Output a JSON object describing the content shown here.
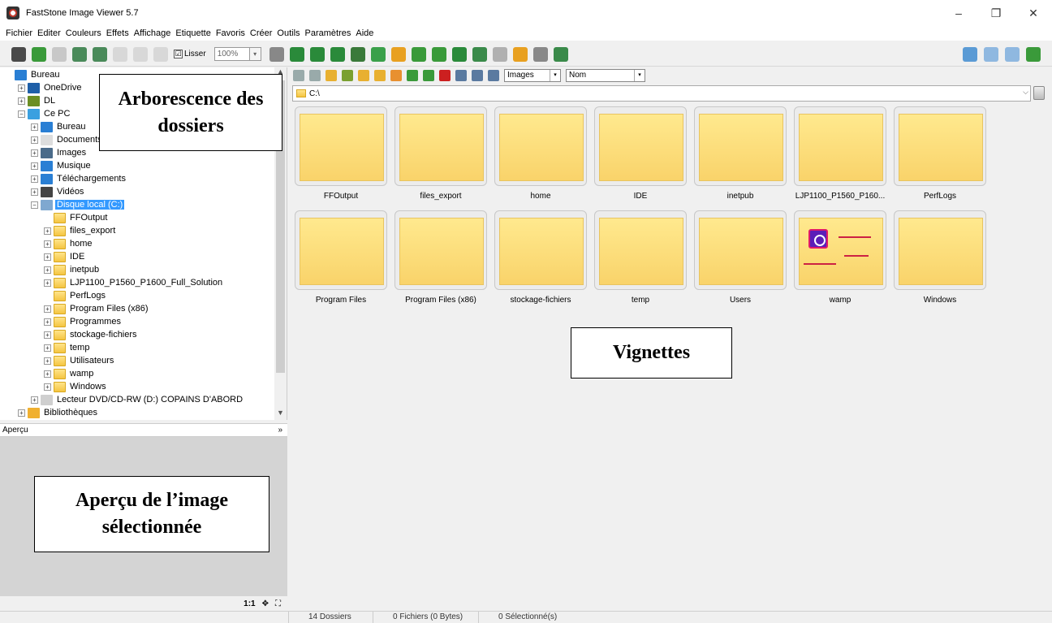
{
  "window": {
    "title": "FastStone Image Viewer 5.7",
    "minimize": "–",
    "restore": "❐",
    "close": "✕"
  },
  "menu": [
    "Fichier",
    "Editer",
    "Couleurs",
    "Effets",
    "Affichage",
    "Etiquette",
    "Favoris",
    "Créer",
    "Outils",
    "Paramètres",
    "Aide"
  ],
  "toolbar": {
    "smooth_label": "Lisser",
    "smooth_checked": "☑",
    "zoom_value": "100%",
    "zoom_dropdown": "▾",
    "hand_dropdown": "▾"
  },
  "tree": {
    "items": [
      {
        "label": "Bureau",
        "indent": 0,
        "expander": "",
        "icon": "desktop-icon",
        "color": "#2a7fd4"
      },
      {
        "label": "OneDrive",
        "indent": 1,
        "expander": "+",
        "icon": "cloud-icon",
        "color": "#1e5fa8"
      },
      {
        "label": "DL",
        "indent": 1,
        "expander": "+",
        "icon": "user-icon",
        "color": "#6b8e23"
      },
      {
        "label": "Ce PC",
        "indent": 1,
        "expander": "−",
        "icon": "computer-icon",
        "color": "#3aa0e0"
      },
      {
        "label": "Bureau",
        "indent": 2,
        "expander": "+",
        "icon": "desktop-icon",
        "color": "#2a7fd4"
      },
      {
        "label": "Documents",
        "indent": 2,
        "expander": "+",
        "icon": "document-icon",
        "color": "#ddd"
      },
      {
        "label": "Images",
        "indent": 2,
        "expander": "+",
        "icon": "images-icon",
        "color": "#4a6b8a"
      },
      {
        "label": "Musique",
        "indent": 2,
        "expander": "+",
        "icon": "music-icon",
        "color": "#2a7fd4"
      },
      {
        "label": "Téléchargements",
        "indent": 2,
        "expander": "+",
        "icon": "download-icon",
        "color": "#2a7fd4"
      },
      {
        "label": "Vidéos",
        "indent": 2,
        "expander": "+",
        "icon": "video-icon",
        "color": "#444"
      },
      {
        "label": "Disque local (C:)",
        "indent": 2,
        "expander": "−",
        "icon": "drive-icon",
        "color": "#7fa8d0",
        "selected": true
      },
      {
        "label": "FFOutput",
        "indent": 3,
        "expander": "",
        "icon": "folder-icon"
      },
      {
        "label": "files_export",
        "indent": 3,
        "expander": "+",
        "icon": "folder-icon"
      },
      {
        "label": "home",
        "indent": 3,
        "expander": "+",
        "icon": "folder-icon"
      },
      {
        "label": "IDE",
        "indent": 3,
        "expander": "+",
        "icon": "folder-icon"
      },
      {
        "label": "inetpub",
        "indent": 3,
        "expander": "+",
        "icon": "folder-icon"
      },
      {
        "label": "LJP1100_P1560_P1600_Full_Solution",
        "indent": 3,
        "expander": "+",
        "icon": "folder-icon"
      },
      {
        "label": "PerfLogs",
        "indent": 3,
        "expander": "",
        "icon": "folder-icon"
      },
      {
        "label": "Program Files (x86)",
        "indent": 3,
        "expander": "+",
        "icon": "folder-icon"
      },
      {
        "label": "Programmes",
        "indent": 3,
        "expander": "+",
        "icon": "folder-icon"
      },
      {
        "label": "stockage-fichiers",
        "indent": 3,
        "expander": "+",
        "icon": "folder-icon"
      },
      {
        "label": "temp",
        "indent": 3,
        "expander": "+",
        "icon": "folder-icon"
      },
      {
        "label": "Utilisateurs",
        "indent": 3,
        "expander": "+",
        "icon": "folder-icon"
      },
      {
        "label": "wamp",
        "indent": 3,
        "expander": "+",
        "icon": "folder-icon"
      },
      {
        "label": "Windows",
        "indent": 3,
        "expander": "+",
        "icon": "folder-icon"
      },
      {
        "label": "Lecteur DVD/CD-RW (D:) COPAINS D'ABORD",
        "indent": 2,
        "expander": "+",
        "icon": "dvd-icon",
        "color": "#cfcfcf"
      },
      {
        "label": "Bibliothèques",
        "indent": 1,
        "expander": "+",
        "icon": "library-icon",
        "color": "#f0b030"
      }
    ]
  },
  "preview": {
    "header": "Aperçu",
    "collapse": "»",
    "footer": {
      "ratio": "1:1",
      "fit_icon": "✥",
      "full_icon": "⛶"
    }
  },
  "nav": {
    "filter_value": "Images",
    "sort_value": "Nom",
    "dropdown": "▾",
    "path": "C:\\",
    "path_dropdown": "⌵"
  },
  "thumbnails": [
    {
      "label": "FFOutput"
    },
    {
      "label": "files_export"
    },
    {
      "label": "home"
    },
    {
      "label": "IDE"
    },
    {
      "label": "inetpub"
    },
    {
      "label": "LJP1100_P1560_P160..."
    },
    {
      "label": "PerfLogs"
    },
    {
      "label": "Program Files"
    },
    {
      "label": "Program Files (x86)"
    },
    {
      "label": "stockage-fichiers"
    },
    {
      "label": "temp"
    },
    {
      "label": "Users"
    },
    {
      "label": "wamp",
      "special": "wamp"
    },
    {
      "label": "Windows"
    }
  ],
  "annotations": {
    "tree": "Arborescence des dossiers",
    "thumbs": "Vignettes",
    "preview": "Aperçu de l’image sélectionnée"
  },
  "status": {
    "folders": "14 Dossiers",
    "files": "0 Fichiers (0 Bytes)",
    "selected": "0 Sélectionné(s)"
  },
  "toolbar_icons": [
    {
      "name": "camera-icon",
      "color": "#4a4a4a"
    },
    {
      "name": "open-folder-icon",
      "color": "#3a9a3a"
    },
    {
      "name": "save-icon",
      "color": "#c8c8c8"
    },
    {
      "name": "save-as-icon",
      "color": "#4a8a5a"
    },
    {
      "name": "export-icon",
      "color": "#4a8a5a"
    },
    {
      "name": "zoom-in-icon",
      "color": "#d8d8d8"
    },
    {
      "name": "zoom-out-icon",
      "color": "#d8d8d8"
    },
    {
      "name": "actual-size-icon",
      "color": "#d8d8d8"
    }
  ],
  "toolbar_icons2": [
    {
      "name": "hand-icon",
      "color": "#888888"
    },
    {
      "name": "slideshow-icon",
      "color": "#2a8a3a"
    },
    {
      "name": "compare-icon",
      "color": "#2a8a3a"
    },
    {
      "name": "batch-icon",
      "color": "#2a8a3a"
    },
    {
      "name": "rename-icon",
      "color": "#3a7a3a"
    },
    {
      "name": "contact-icon",
      "color": "#3aa04a"
    },
    {
      "name": "effects-icon",
      "color": "#e8a020"
    },
    {
      "name": "rotate-left-icon",
      "color": "#3a9a3a"
    },
    {
      "name": "rotate-right-icon",
      "color": "#3a9a3a"
    },
    {
      "name": "histogram-icon",
      "color": "#2a8a3a"
    },
    {
      "name": "resize-icon",
      "color": "#3a8a4a"
    },
    {
      "name": "draw-icon",
      "color": "#b0b0b0"
    },
    {
      "name": "email-icon",
      "color": "#e8a020"
    },
    {
      "name": "print-icon",
      "color": "#888888"
    },
    {
      "name": "settings-icon",
      "color": "#3a8a4a"
    }
  ],
  "layout_icons": [
    {
      "name": "layout-browser-icon",
      "color": "#5b9bd5"
    },
    {
      "name": "layout-single-icon",
      "color": "#8fb8e0"
    },
    {
      "name": "layout-preview-icon",
      "color": "#8fb8e0"
    },
    {
      "name": "fullscreen-icon",
      "color": "#3a9a3a"
    }
  ],
  "nav_icons": [
    {
      "name": "back-icon",
      "color": "#9aa"
    },
    {
      "name": "forward-icon",
      "color": "#9aa"
    },
    {
      "name": "up-folder-icon",
      "color": "#e8b030"
    },
    {
      "name": "folder-green-icon",
      "color": "#7aa030"
    },
    {
      "name": "favorites-folder-icon",
      "color": "#e8b030"
    },
    {
      "name": "new-folder-icon",
      "color": "#e8b030"
    },
    {
      "name": "copy-to-icon",
      "color": "#e89030"
    },
    {
      "name": "move-to-icon",
      "color": "#3a9a3a"
    },
    {
      "name": "refresh-icon",
      "color": "#3a9a3a"
    },
    {
      "name": "delete-icon",
      "color": "#cc2020"
    },
    {
      "name": "thumbnails-view-icon",
      "color": "#5a7aa0"
    },
    {
      "name": "list-view-icon",
      "color": "#5a7aa0"
    },
    {
      "name": "details-view-icon",
      "color": "#5a7aa0"
    }
  ]
}
